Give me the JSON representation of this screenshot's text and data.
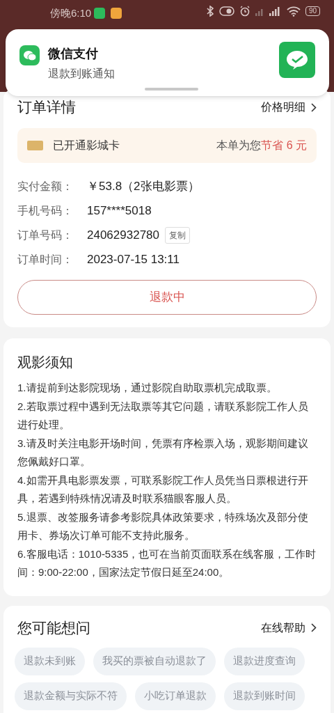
{
  "status_bar": {
    "time": "傍晚6:10",
    "battery": "90"
  },
  "notification": {
    "app": "微信支付",
    "message": "退款到账通知"
  },
  "order": {
    "title": "订单详情",
    "link": "价格明细",
    "card_banner": {
      "label": "已开通影城卡",
      "saving_prefix": "本单为您",
      "saving_highlight": "节省 6 元"
    },
    "fields": [
      {
        "label": "实付金额：",
        "value": "￥53.8（2张电影票）"
      },
      {
        "label": "手机号码：",
        "value": "157****5018"
      },
      {
        "label": "订单号码：",
        "value": "24062932780",
        "action": "复制"
      },
      {
        "label": "订单时间：",
        "value": "2023-07-15 13:11"
      }
    ],
    "status_button": "退款中"
  },
  "notice": {
    "title": "观影须知",
    "items": [
      "1.请提前到达影院现场，通过影院自助取票机完成取票。",
      "2.若取票过程中遇到无法取票等其它问题，请联系影院工作人员进行处理。",
      "3.请及时关注电影开场时间，凭票有序检票入场，观影期间建议您佩戴好口罩。",
      "4.如需开具电影票发票，可联系影院工作人员凭当日票根进行开具，若遇到特殊情况请及时联系猫眼客服人员。",
      "5.退票、改签服务请参考影院具体政策要求，特殊场次及部分使用卡、券场次订单可能不支持此服务。",
      "6.客服电话：1010-5335，也可在当前页面联系在线客服，工作时间：9:00-22:00，国家法定节假日延至24:00。"
    ]
  },
  "faq": {
    "title": "您可能想问",
    "link": "在线帮助",
    "questions": [
      "退款未到账",
      "我买的票被自动退款了",
      "退款进度查询",
      "退款金额与实际不符",
      "小吃订单退款",
      "退款到账时间"
    ]
  }
}
